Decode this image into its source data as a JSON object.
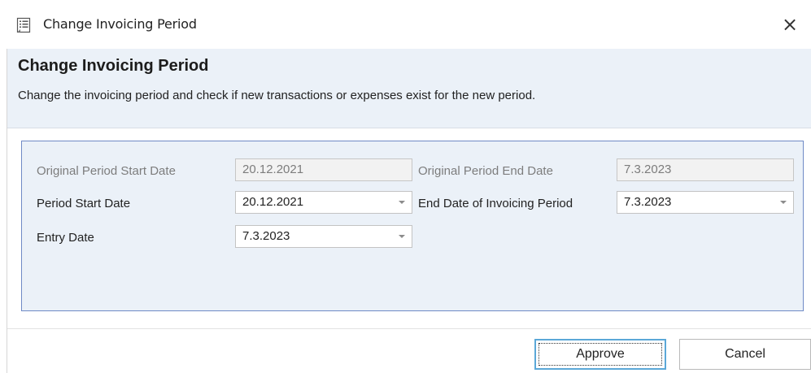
{
  "window": {
    "title": "Change Invoicing Period",
    "close_label": "×"
  },
  "header": {
    "title": "Change Invoicing Period",
    "description": "Change the invoicing period and check if new transactions or expenses exist for the new period."
  },
  "form": {
    "original_start": {
      "label": "Original Period Start Date",
      "value": "20.12.2021"
    },
    "original_end": {
      "label": "Original Period End Date",
      "value": "7.3.2023"
    },
    "period_start": {
      "label": "Period Start Date",
      "value": "20.12.2021"
    },
    "period_end": {
      "label": "End Date of Invoicing Period",
      "value": "7.3.2023"
    },
    "entry_date": {
      "label": "Entry Date",
      "value": "7.3.2023"
    }
  },
  "buttons": {
    "approve": "Approve",
    "cancel": "Cancel"
  },
  "icons": {
    "title_icon": "document-list-icon",
    "dropdown": "chevron-down-icon"
  },
  "colors": {
    "panel_background": "#ebf1f8",
    "panel_border": "#6f8ac6",
    "focus_border": "#5ba8d8"
  }
}
